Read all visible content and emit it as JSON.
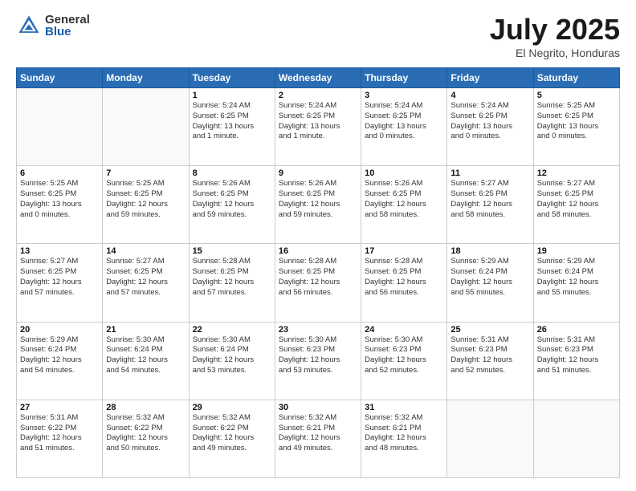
{
  "header": {
    "logo_general": "General",
    "logo_blue": "Blue",
    "title": "July 2025",
    "location": "El Negrito, Honduras"
  },
  "days_of_week": [
    "Sunday",
    "Monday",
    "Tuesday",
    "Wednesday",
    "Thursday",
    "Friday",
    "Saturday"
  ],
  "weeks": [
    [
      {
        "day": "",
        "info": ""
      },
      {
        "day": "",
        "info": ""
      },
      {
        "day": "1",
        "info": "Sunrise: 5:24 AM\nSunset: 6:25 PM\nDaylight: 13 hours\nand 1 minute."
      },
      {
        "day": "2",
        "info": "Sunrise: 5:24 AM\nSunset: 6:25 PM\nDaylight: 13 hours\nand 1 minute."
      },
      {
        "day": "3",
        "info": "Sunrise: 5:24 AM\nSunset: 6:25 PM\nDaylight: 13 hours\nand 0 minutes."
      },
      {
        "day": "4",
        "info": "Sunrise: 5:24 AM\nSunset: 6:25 PM\nDaylight: 13 hours\nand 0 minutes."
      },
      {
        "day": "5",
        "info": "Sunrise: 5:25 AM\nSunset: 6:25 PM\nDaylight: 13 hours\nand 0 minutes."
      }
    ],
    [
      {
        "day": "6",
        "info": "Sunrise: 5:25 AM\nSunset: 6:25 PM\nDaylight: 13 hours\nand 0 minutes."
      },
      {
        "day": "7",
        "info": "Sunrise: 5:25 AM\nSunset: 6:25 PM\nDaylight: 12 hours\nand 59 minutes."
      },
      {
        "day": "8",
        "info": "Sunrise: 5:26 AM\nSunset: 6:25 PM\nDaylight: 12 hours\nand 59 minutes."
      },
      {
        "day": "9",
        "info": "Sunrise: 5:26 AM\nSunset: 6:25 PM\nDaylight: 12 hours\nand 59 minutes."
      },
      {
        "day": "10",
        "info": "Sunrise: 5:26 AM\nSunset: 6:25 PM\nDaylight: 12 hours\nand 58 minutes."
      },
      {
        "day": "11",
        "info": "Sunrise: 5:27 AM\nSunset: 6:25 PM\nDaylight: 12 hours\nand 58 minutes."
      },
      {
        "day": "12",
        "info": "Sunrise: 5:27 AM\nSunset: 6:25 PM\nDaylight: 12 hours\nand 58 minutes."
      }
    ],
    [
      {
        "day": "13",
        "info": "Sunrise: 5:27 AM\nSunset: 6:25 PM\nDaylight: 12 hours\nand 57 minutes."
      },
      {
        "day": "14",
        "info": "Sunrise: 5:27 AM\nSunset: 6:25 PM\nDaylight: 12 hours\nand 57 minutes."
      },
      {
        "day": "15",
        "info": "Sunrise: 5:28 AM\nSunset: 6:25 PM\nDaylight: 12 hours\nand 57 minutes."
      },
      {
        "day": "16",
        "info": "Sunrise: 5:28 AM\nSunset: 6:25 PM\nDaylight: 12 hours\nand 56 minutes."
      },
      {
        "day": "17",
        "info": "Sunrise: 5:28 AM\nSunset: 6:25 PM\nDaylight: 12 hours\nand 56 minutes."
      },
      {
        "day": "18",
        "info": "Sunrise: 5:29 AM\nSunset: 6:24 PM\nDaylight: 12 hours\nand 55 minutes."
      },
      {
        "day": "19",
        "info": "Sunrise: 5:29 AM\nSunset: 6:24 PM\nDaylight: 12 hours\nand 55 minutes."
      }
    ],
    [
      {
        "day": "20",
        "info": "Sunrise: 5:29 AM\nSunset: 6:24 PM\nDaylight: 12 hours\nand 54 minutes."
      },
      {
        "day": "21",
        "info": "Sunrise: 5:30 AM\nSunset: 6:24 PM\nDaylight: 12 hours\nand 54 minutes."
      },
      {
        "day": "22",
        "info": "Sunrise: 5:30 AM\nSunset: 6:24 PM\nDaylight: 12 hours\nand 53 minutes."
      },
      {
        "day": "23",
        "info": "Sunrise: 5:30 AM\nSunset: 6:23 PM\nDaylight: 12 hours\nand 53 minutes."
      },
      {
        "day": "24",
        "info": "Sunrise: 5:30 AM\nSunset: 6:23 PM\nDaylight: 12 hours\nand 52 minutes."
      },
      {
        "day": "25",
        "info": "Sunrise: 5:31 AM\nSunset: 6:23 PM\nDaylight: 12 hours\nand 52 minutes."
      },
      {
        "day": "26",
        "info": "Sunrise: 5:31 AM\nSunset: 6:23 PM\nDaylight: 12 hours\nand 51 minutes."
      }
    ],
    [
      {
        "day": "27",
        "info": "Sunrise: 5:31 AM\nSunset: 6:22 PM\nDaylight: 12 hours\nand 51 minutes."
      },
      {
        "day": "28",
        "info": "Sunrise: 5:32 AM\nSunset: 6:22 PM\nDaylight: 12 hours\nand 50 minutes."
      },
      {
        "day": "29",
        "info": "Sunrise: 5:32 AM\nSunset: 6:22 PM\nDaylight: 12 hours\nand 49 minutes."
      },
      {
        "day": "30",
        "info": "Sunrise: 5:32 AM\nSunset: 6:21 PM\nDaylight: 12 hours\nand 49 minutes."
      },
      {
        "day": "31",
        "info": "Sunrise: 5:32 AM\nSunset: 6:21 PM\nDaylight: 12 hours\nand 48 minutes."
      },
      {
        "day": "",
        "info": ""
      },
      {
        "day": "",
        "info": ""
      }
    ]
  ]
}
